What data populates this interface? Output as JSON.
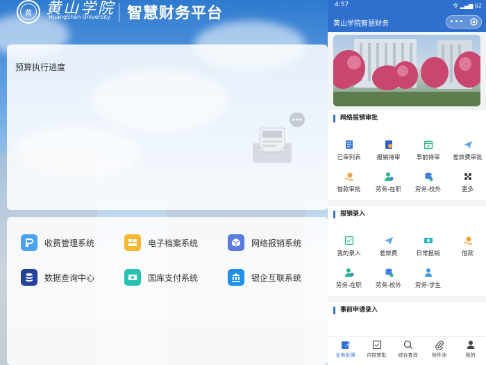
{
  "header": {
    "logo_cn": "黄山学院",
    "logo_en": "HuangShan University",
    "seal_text": "黄",
    "title": "智慧财务平台"
  },
  "budget": {
    "title": "预算执行进度"
  },
  "systems": [
    {
      "label": "收费管理系统",
      "icon": "payment-icon",
      "color": "#4aa3f0"
    },
    {
      "label": "电子档案系统",
      "icon": "archive-icon",
      "color": "#f5b82e"
    },
    {
      "label": "网络报销系统",
      "icon": "cube-icon",
      "color": "#5b7be0"
    },
    {
      "label": "数据查询中心",
      "icon": "database-icon",
      "color": "#23409c"
    },
    {
      "label": "国库支付系统",
      "icon": "money-icon",
      "color": "#27c3b0"
    },
    {
      "label": "银企互联系统",
      "icon": "bank-icon",
      "color": "#1f8fe8"
    }
  ],
  "phone": {
    "status": {
      "time": "4:57",
      "signal": "令 ▂▄▆ 62"
    },
    "nav_title": "黄山学院智慧财务",
    "sections": [
      {
        "title": "网络报销审批",
        "items": [
          {
            "label": "已审列表",
            "color": "#3d7be6"
          },
          {
            "label": "报销待审",
            "color": "#3d7be6"
          },
          {
            "label": "事前待审",
            "color": "#27b58a"
          },
          {
            "label": "差旅费审批",
            "color": "#5aa5e8"
          },
          {
            "label": "借款审批",
            "color": "#f2a03a"
          },
          {
            "label": "劳务-在职",
            "color": "#27b58a"
          },
          {
            "label": "劳务-校外",
            "color": "#3d7be6"
          },
          {
            "label": "更多",
            "color": "#333333"
          }
        ]
      },
      {
        "title": "报销录入",
        "items": [
          {
            "label": "我的录入",
            "color": "#27b58a"
          },
          {
            "label": "差旅费",
            "color": "#5aa5e8"
          },
          {
            "label": "日常报销",
            "color": "#27b5c8"
          },
          {
            "label": "借款",
            "color": "#f2a03a"
          },
          {
            "label": "劳务-在职",
            "color": "#27b58a"
          },
          {
            "label": "劳务-校外",
            "color": "#3d7be6"
          },
          {
            "label": "劳务-学生",
            "color": "#3d9be6"
          }
        ]
      },
      {
        "title": "事前申请录入",
        "items": []
      }
    ],
    "tabs": [
      {
        "label": "业务处理",
        "icon": "edit-icon"
      },
      {
        "label": "内控审批",
        "icon": "approve-icon"
      },
      {
        "label": "综合查询",
        "icon": "search-icon"
      },
      {
        "label": "附件池",
        "icon": "paperclip-icon"
      },
      {
        "label": "我的",
        "icon": "user-icon"
      }
    ]
  }
}
